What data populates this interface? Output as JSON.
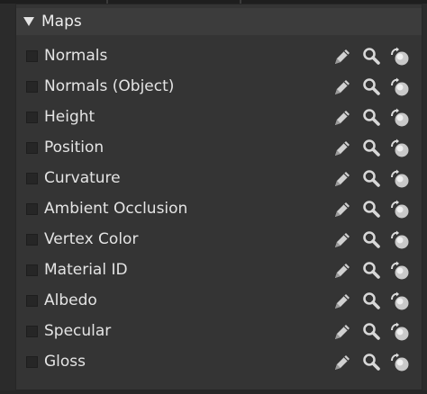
{
  "section": {
    "title": "Maps",
    "collapse_icon": "triangle-down-icon"
  },
  "maps": [
    {
      "label": "Normals",
      "checked": false
    },
    {
      "label": "Normals (Object)",
      "checked": false
    },
    {
      "label": "Height",
      "checked": false
    },
    {
      "label": "Position",
      "checked": false
    },
    {
      "label": "Curvature",
      "checked": false
    },
    {
      "label": "Ambient Occlusion",
      "checked": false
    },
    {
      "label": "Vertex Color",
      "checked": false
    },
    {
      "label": "Material ID",
      "checked": false
    },
    {
      "label": "Albedo",
      "checked": false
    },
    {
      "label": "Specular",
      "checked": false
    },
    {
      "label": "Gloss",
      "checked": false
    }
  ],
  "row_actions": [
    "pencil-icon",
    "magnifier-icon",
    "sphere-reset-icon"
  ],
  "colors": {
    "panel": "#343434",
    "header": "#3c3c3c",
    "text": "#e4e4e4",
    "icon": "#d0d0d0"
  }
}
